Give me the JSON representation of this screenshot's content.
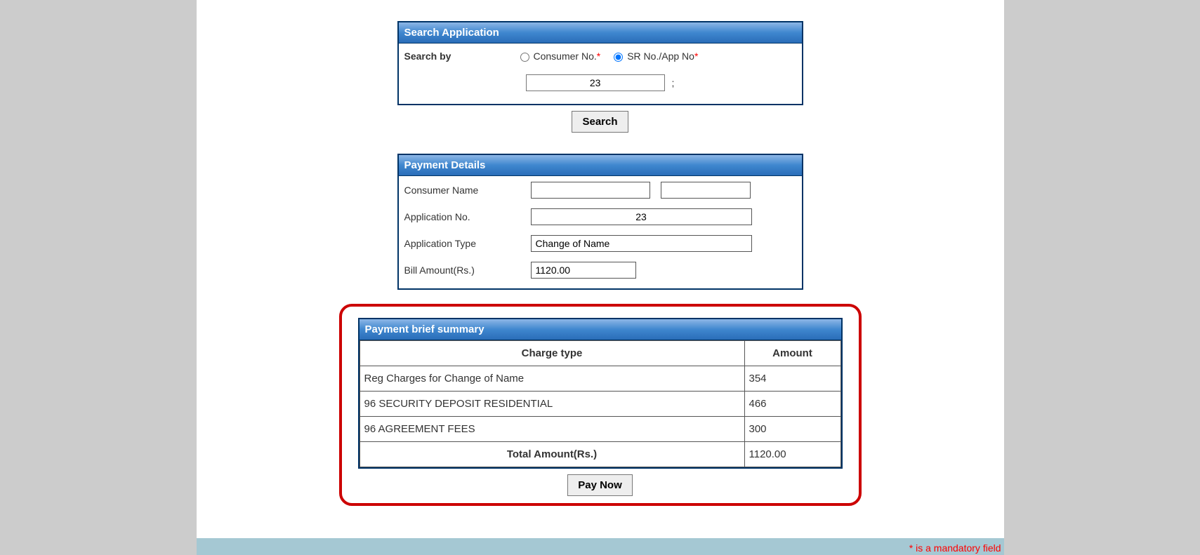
{
  "search": {
    "header": "Search Application",
    "label": "Search by",
    "option1": "Consumer No.",
    "option2": "SR No./App No",
    "star": "*",
    "inputValue": "23",
    "semicolon": ";",
    "buttonLabel": "Search"
  },
  "details": {
    "header": "Payment Details",
    "consumerNameLabel": "Consumer Name",
    "consumerFirst": "",
    "consumerLast": "",
    "appNoLabel": "Application No.",
    "appNoValue": "23",
    "appTypeLabel": "Application Type",
    "appTypeValue": "Change of Name",
    "billAmtLabel": "Bill Amount(Rs.)",
    "billAmtValue": "1120.00"
  },
  "summary": {
    "header": "Payment brief summary",
    "colCharge": "Charge type",
    "colAmount": "Amount",
    "rows": [
      {
        "charge": "Reg Charges for Change of Name",
        "amount": "354"
      },
      {
        "charge": "96 SECURITY DEPOSIT RESIDENTIAL",
        "amount": "466"
      },
      {
        "charge": "96 AGREEMENT FEES",
        "amount": "300"
      }
    ],
    "totalLabel": "Total Amount(Rs.)",
    "totalValue": "1120.00",
    "payNowLabel": "Pay Now"
  },
  "footer": {
    "mandatoryNote": "* is a mandatory field"
  }
}
